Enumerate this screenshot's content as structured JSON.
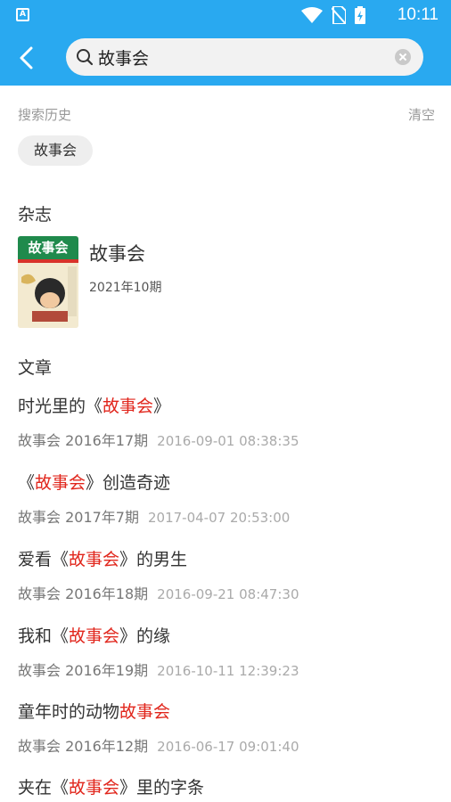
{
  "status": {
    "time": "10:11",
    "app_icon_letter": "A"
  },
  "search": {
    "value": "故事会",
    "placeholder": ""
  },
  "history": {
    "label": "搜索历史",
    "clear_label": "清空",
    "items": [
      "故事会"
    ]
  },
  "magazines": {
    "section_label": "杂志",
    "items": [
      {
        "name": "故事会",
        "issue": "2021年10期",
        "cover_title": "故事会"
      }
    ]
  },
  "articles": {
    "section_label": "文章",
    "items": [
      {
        "title_pre": "时光里的《",
        "title_hl": "故事会",
        "title_post": "》",
        "source": "故事会 2016年17期",
        "date": "2016-09-01 08:38:35"
      },
      {
        "title_pre": "《",
        "title_hl": "故事会",
        "title_post": "》创造奇迹",
        "source": "故事会 2017年7期",
        "date": "2017-04-07 20:53:00"
      },
      {
        "title_pre": "爱看《",
        "title_hl": "故事会",
        "title_post": "》的男生",
        "source": "故事会 2016年18期",
        "date": "2016-09-21 08:47:30"
      },
      {
        "title_pre": "我和《",
        "title_hl": "故事会",
        "title_post": "》的缘",
        "source": "故事会 2016年19期",
        "date": "2016-10-11 12:39:23"
      },
      {
        "title_pre": "童年时的动物",
        "title_hl": "故事会",
        "title_post": "",
        "source": "故事会 2016年12期",
        "date": "2016-06-17 09:01:40"
      },
      {
        "title_pre": "夹在《",
        "title_hl": "故事会",
        "title_post": "》里的字条",
        "source": "",
        "date": ""
      }
    ]
  },
  "colors": {
    "primary": "#29a9f0",
    "highlight": "#e1261c"
  }
}
